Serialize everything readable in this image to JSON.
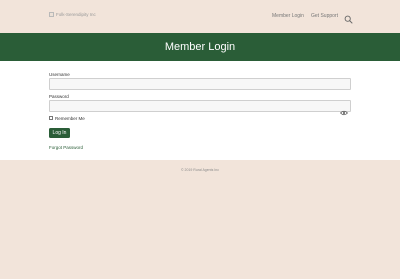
{
  "header": {
    "logo_alt": "Folk-Serendipity Inc",
    "nav": {
      "login": "Member Login",
      "support": "Get Support"
    },
    "search_icon": "search-icon"
  },
  "banner": {
    "title": "Member Login"
  },
  "form": {
    "username_label": "Username",
    "username_value": "",
    "password_label": "Password",
    "password_value": "",
    "password_toggle_icon": "eye-icon",
    "remember_label": "Remember Me",
    "remember_checked": false,
    "submit_label": "Log In",
    "forgot_label": "Forgot Password"
  },
  "footer": {
    "copyright": "© 2019 Rural Agents Inc"
  },
  "colors": {
    "page_background": "#f2e4da",
    "brand_green": "#2a5d37",
    "content_background": "#ffffff"
  }
}
